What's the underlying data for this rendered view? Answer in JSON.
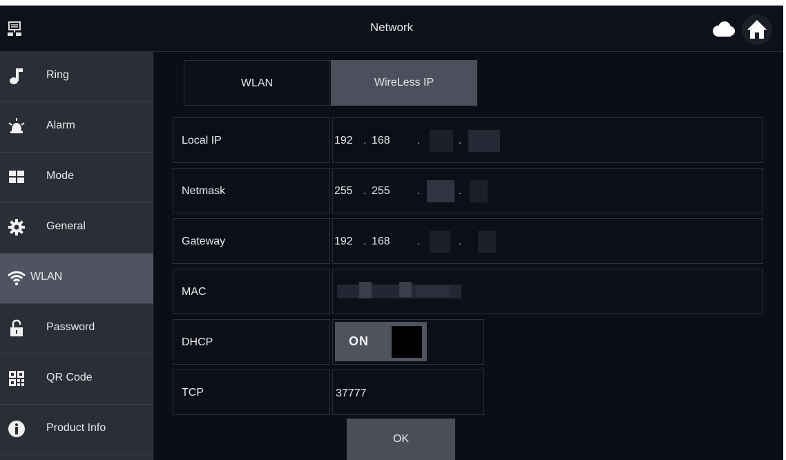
{
  "header": {
    "title": "Network",
    "icons": [
      "network-icon",
      "cloud-icon",
      "home-icon"
    ]
  },
  "sidebar": {
    "items": [
      {
        "label": "Ring",
        "icon": "music-note-icon"
      },
      {
        "label": "Alarm",
        "icon": "siren-icon"
      },
      {
        "label": "Mode",
        "icon": "grid-icon"
      },
      {
        "label": "General",
        "icon": "gear-icon"
      },
      {
        "label": "WLAN",
        "icon": "wifi-icon",
        "active": true
      },
      {
        "label": "Password",
        "icon": "lock-icon"
      },
      {
        "label": "QR Code",
        "icon": "qr-code-icon"
      },
      {
        "label": "Product Info",
        "icon": "info-icon"
      }
    ]
  },
  "tabs": [
    {
      "label": "WLAN",
      "selected": false
    },
    {
      "label": "WireLess IP",
      "selected": true
    }
  ],
  "form": {
    "local_ip": {
      "label": "Local IP",
      "oct1": "192",
      "oct2": "168",
      "sep": "."
    },
    "netmask": {
      "label": "Netmask",
      "oct1": "255",
      "oct2": "255",
      "sep": "."
    },
    "gateway": {
      "label": "Gateway",
      "oct1": "192",
      "oct2": "168",
      "sep": "."
    },
    "mac": {
      "label": "MAC"
    },
    "dhcp": {
      "label": "DHCP",
      "state": "ON"
    },
    "tcp": {
      "label": "TCP",
      "value": "37777"
    }
  },
  "ok_label": "OK",
  "colors": {
    "background": "#0b0e17",
    "sidebar": "#2b2e37",
    "active": "#505361",
    "button": "#4b4e59"
  }
}
